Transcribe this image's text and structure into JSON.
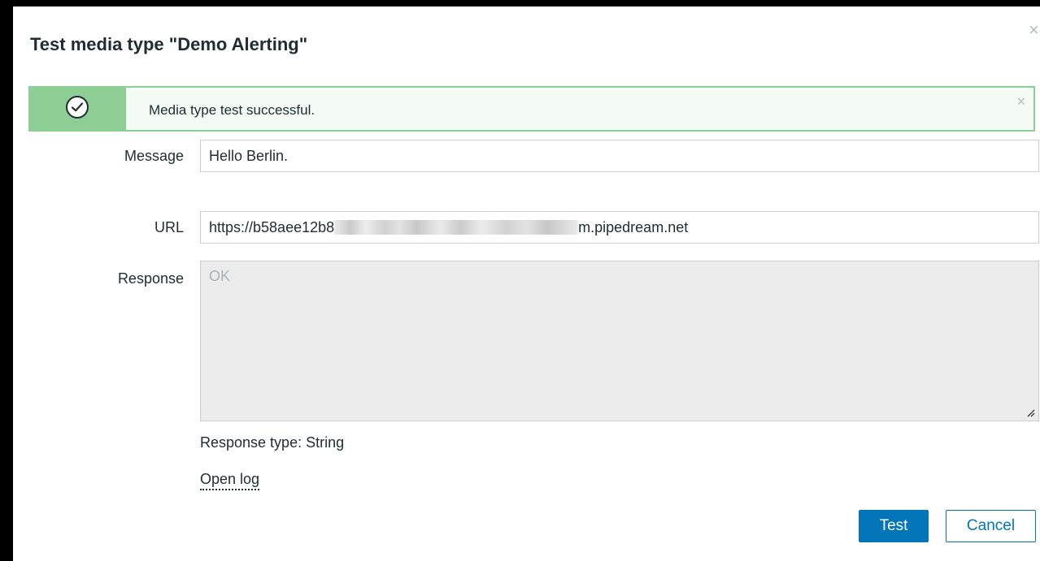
{
  "dialog": {
    "title": "Test media type \"Demo Alerting\"",
    "close_icon": "close-icon"
  },
  "message_box": {
    "text": "Media type test successful.",
    "status": "success",
    "icon": "check-circle-icon",
    "accent_color": "#8cce94"
  },
  "form": {
    "message": {
      "label": "Message",
      "value": "Hello Berlin."
    },
    "url": {
      "label": "URL",
      "value_prefix": "https://b58aee12b8",
      "value_suffix": "m.pipedream.net"
    },
    "response": {
      "label": "Response",
      "value": "OK"
    },
    "response_type": "Response type: String",
    "open_log": "Open log"
  },
  "buttons": {
    "test": "Test",
    "cancel": "Cancel",
    "primary_color": "#0275b8"
  }
}
